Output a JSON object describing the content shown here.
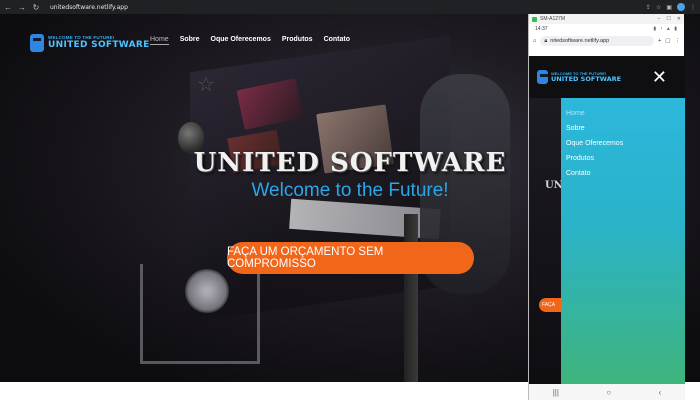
{
  "browser": {
    "url": "unitedsoftware.netlify.app"
  },
  "site": {
    "logo": {
      "small": "WELCOME TO THE FUTURE!",
      "big": "UNITED SOFTWARE"
    },
    "nav": {
      "items": [
        {
          "label": "Home",
          "active": true
        },
        {
          "label": "Sobre",
          "active": false
        },
        {
          "label": "Oque Oferecemos",
          "active": false
        },
        {
          "label": "Produtos",
          "active": false
        },
        {
          "label": "Contato",
          "active": false
        }
      ]
    },
    "hero": {
      "title": "UNITED SOFTWARE",
      "subtitle": "Welcome to the Future!",
      "cta": "FAÇA UM ORÇAMENTO SEM COMPROMISSO"
    }
  },
  "phone": {
    "window_title": "SM-A127M",
    "time": "14:37",
    "url": "nitedsoftware.netlify.app",
    "logo": {
      "small": "WELCOME TO THE FUTURE!",
      "big": "UNITED SOFTWARE"
    },
    "hero_title_partial": "UN",
    "cta_partial": "FAÇA",
    "drawer": {
      "items": [
        {
          "label": "Home",
          "active": true
        },
        {
          "label": "Sobre",
          "active": false
        },
        {
          "label": "Oque Oferecemos",
          "active": false
        },
        {
          "label": "Produtos",
          "active": false
        },
        {
          "label": "Contato",
          "active": false
        }
      ]
    }
  },
  "colors": {
    "accent_orange": "#f2661a",
    "accent_blue": "#2aa7e8",
    "drawer_top": "#2cb7dc",
    "drawer_bottom": "#3fb47c"
  }
}
